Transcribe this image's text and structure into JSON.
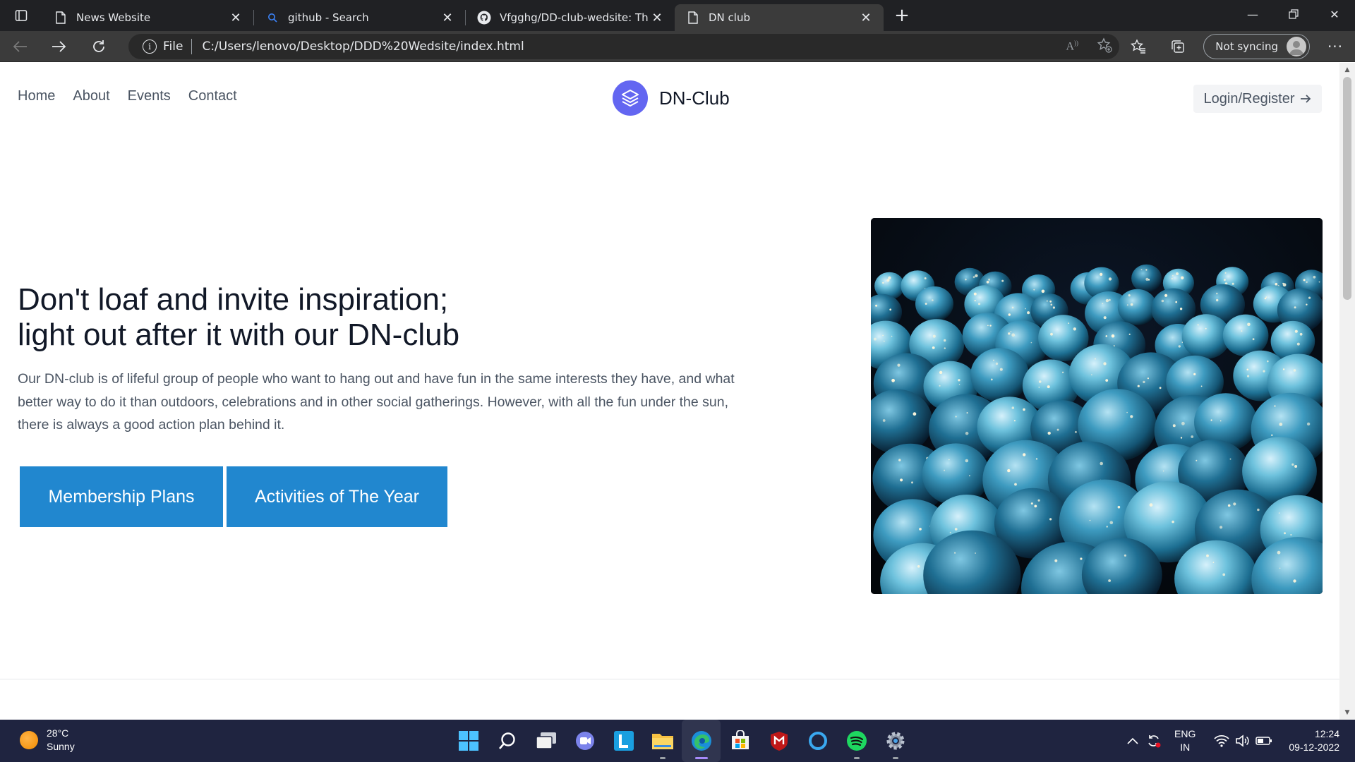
{
  "browser": {
    "tabs": [
      {
        "title": "News Website",
        "icon": "page-icon",
        "active": false
      },
      {
        "title": "github - Search",
        "icon": "search-icon",
        "active": false
      },
      {
        "title": "Vfgghg/DD-club-wedsite: This is",
        "icon": "github-icon",
        "active": false
      },
      {
        "title": "DN club",
        "icon": "page-icon",
        "active": true
      }
    ],
    "address": {
      "scheme_label": "File",
      "url": "C:/Users/lenovo/Desktop/DDD%20Wedsite/index.html"
    },
    "profile_label": "Not syncing"
  },
  "site": {
    "nav": [
      "Home",
      "About",
      "Events",
      "Contact"
    ],
    "brand": "DN-Club",
    "login_label": "Login/Register",
    "hero": {
      "title_line1": "Don't loaf and invite inspiration;",
      "title_line2": "light out after it with our DN-club",
      "text_line1": "Our DN-club is of lifeful group of people who want to hang out and have fun in the same interests they have, and what",
      "text_line2": "better way to do it than outdoors, celebrations and in other social gatherings. However, with all the fun under the sun,",
      "text_line3": "there is always a good action plan behind it.",
      "button1": "Membership Plans",
      "button2": "Activities of The Year"
    },
    "accent_color": "#2187cf",
    "logo_color": "#6366f1"
  },
  "taskbar": {
    "weather": {
      "temp": "28°C",
      "condition": "Sunny"
    },
    "apps": [
      "start-icon",
      "search-icon",
      "task-view-icon",
      "teams-icon",
      "l-app-icon",
      "file-explorer-icon",
      "edge-icon",
      "store-icon",
      "mcafee-icon",
      "cortana-icon",
      "spotify-icon",
      "settings-icon"
    ],
    "lang_line1": "ENG",
    "lang_line2": "IN",
    "time": "12:24",
    "date": "09-12-2022"
  }
}
